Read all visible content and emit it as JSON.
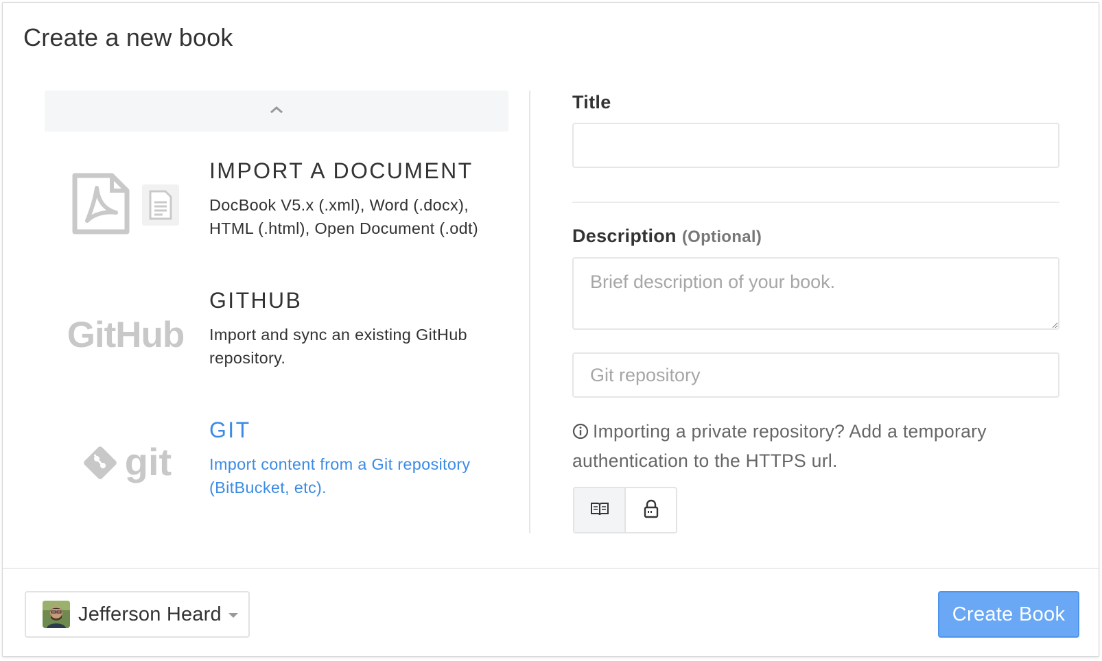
{
  "modal": {
    "title": "Create a new book"
  },
  "sources": [
    {
      "title": "IMPORT A DOCUMENT",
      "description": "DocBook V5.x (.xml), Word (.docx), HTML (.html), Open Document (.odt)",
      "icon": "pdf-document-icon"
    },
    {
      "title": "GITHUB",
      "description": "Import and sync an existing GitHub repository.",
      "icon": "github-logo",
      "logo_text": "GitHub"
    },
    {
      "title": "GIT",
      "description": "Import content from a Git repository (BitBucket, etc).",
      "icon": "git-logo",
      "logo_text": "git",
      "active": true
    }
  ],
  "form": {
    "title_label": "Title",
    "title_value": "",
    "description_label": "Description",
    "description_optional": "(Optional)",
    "description_placeholder": "Brief description of your book.",
    "repo_placeholder": "Git repository",
    "hint": "Importing a private repository? Add a temporary authentication to the HTTPS url."
  },
  "visibility": {
    "options": [
      "public-book-icon",
      "private-lock-icon"
    ],
    "selected": "public-book-icon"
  },
  "footer": {
    "owner_name": "Jefferson Heard",
    "create_label": "Create Book"
  },
  "colors": {
    "accent": "#3b8be6",
    "primary_button": "#6aa8f5",
    "logo_gray": "#c8c8c8"
  }
}
